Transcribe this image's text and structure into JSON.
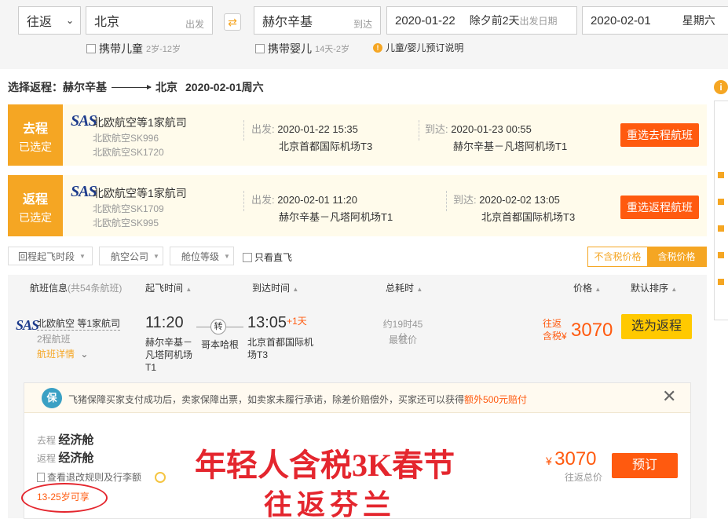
{
  "search": {
    "trip_type": "往返",
    "from_city": "北京",
    "from_hint": "出发",
    "to_city": "赫尔辛基",
    "to_hint": "到达",
    "depart_date": "2020-01-22",
    "depart_note": "除夕前2天",
    "depart_hint": "出发日期",
    "return_date": "2020-02-01",
    "return_note": "星期六",
    "with_child": "携带儿童",
    "child_age": "2岁-12岁",
    "with_infant": "携带婴儿",
    "infant_age": "14天-2岁",
    "child_info": "儿童/婴儿预订说明"
  },
  "page_title": {
    "label": "选择返程：赫尔辛基",
    "dest": "北京",
    "date": "2020-02-01周六"
  },
  "legs": [
    {
      "badge_top": "去程",
      "badge_bottom": "已选定",
      "airline": "北欧航空等1家航司",
      "flights": [
        "北欧航空SK996",
        "北欧航空SK1720"
      ],
      "depart_label": "出发:",
      "depart_time": "2020-01-22 15:35",
      "depart_airport": "北京首都国际机场T3",
      "arrive_label": "到达:",
      "arrive_time": "2020-01-23 00:55",
      "arrive_airport": "赫尔辛基－凡塔阿机场T1",
      "button": "重选去程航班"
    },
    {
      "badge_top": "返程",
      "badge_bottom": "已选定",
      "airline": "北欧航空等1家航司",
      "flights": [
        "北欧航空SK1709",
        "北欧航空SK995"
      ],
      "depart_label": "出发:",
      "depart_time": "2020-02-01 11:20",
      "depart_airport": "赫尔辛基－凡塔阿机场T1",
      "arrive_label": "到达:",
      "arrive_time": "2020-02-02 13:05",
      "arrive_airport": "北京首都国际机场T3",
      "button": "重选返程航班"
    }
  ],
  "filters": {
    "depart_period": "回程起飞时段",
    "airline": "航空公司",
    "cabin": "舱位等级",
    "direct_only": "只看直飞",
    "tax_excluded": "不含税价格",
    "tax_included": "含税价格"
  },
  "table_header": {
    "flight_info": "航班信息",
    "flight_count": "(共54条航班)",
    "depart_time": "起飞时间",
    "arrive_time": "到达时间",
    "duration": "总耗时",
    "price": "价格",
    "sort": "默认排序"
  },
  "flight": {
    "airline": "北欧航空 等1家航司",
    "legs_count": "2程航班",
    "details_link": "航班详情",
    "depart_time": "11:20",
    "depart_airport_line1": "赫尔辛基－",
    "depart_airport_line2": "凡塔阿机场",
    "depart_terminal": "T1",
    "transfer_mark": "转",
    "transfer_city": "哥本哈根",
    "arrive_time": "13:05",
    "plus_day": "+1天",
    "arrive_airport_line1": "北京首都国际机",
    "arrive_airport_line2": "场T3",
    "duration": "约19时45分",
    "duration_note": "最低价",
    "price_label_1": "往返",
    "price_label_2": "含税",
    "price_symbol": "¥",
    "price": "3070",
    "select_button": "选为返程"
  },
  "detail": {
    "guarantee_text": "飞猪保障买家支付成功后，卖家保障出票，如卖家未履行承诺，除差价赔偿外，买家还可以获得",
    "guarantee_highlight": "额外500元赔付",
    "guarantee_badge": "保",
    "outbound_label": "去程",
    "outbound_cabin": "经济舱",
    "return_label": "返程",
    "return_cabin": "经济舱",
    "rules_link": "查看退改规则及行李额",
    "age_note": "13-25岁可享",
    "price_symbol": "¥",
    "price": "3070",
    "price_note": "往返总价",
    "book_button": "预订"
  },
  "overlay": {
    "line1": "年轻人含税3K春节",
    "line2": "往返芬兰"
  },
  "colors": {
    "accent": "#f5a623",
    "orange_button": "#ff5a0f",
    "overlay_red": "#e4262e",
    "sas_blue": "#1d3b8c"
  }
}
